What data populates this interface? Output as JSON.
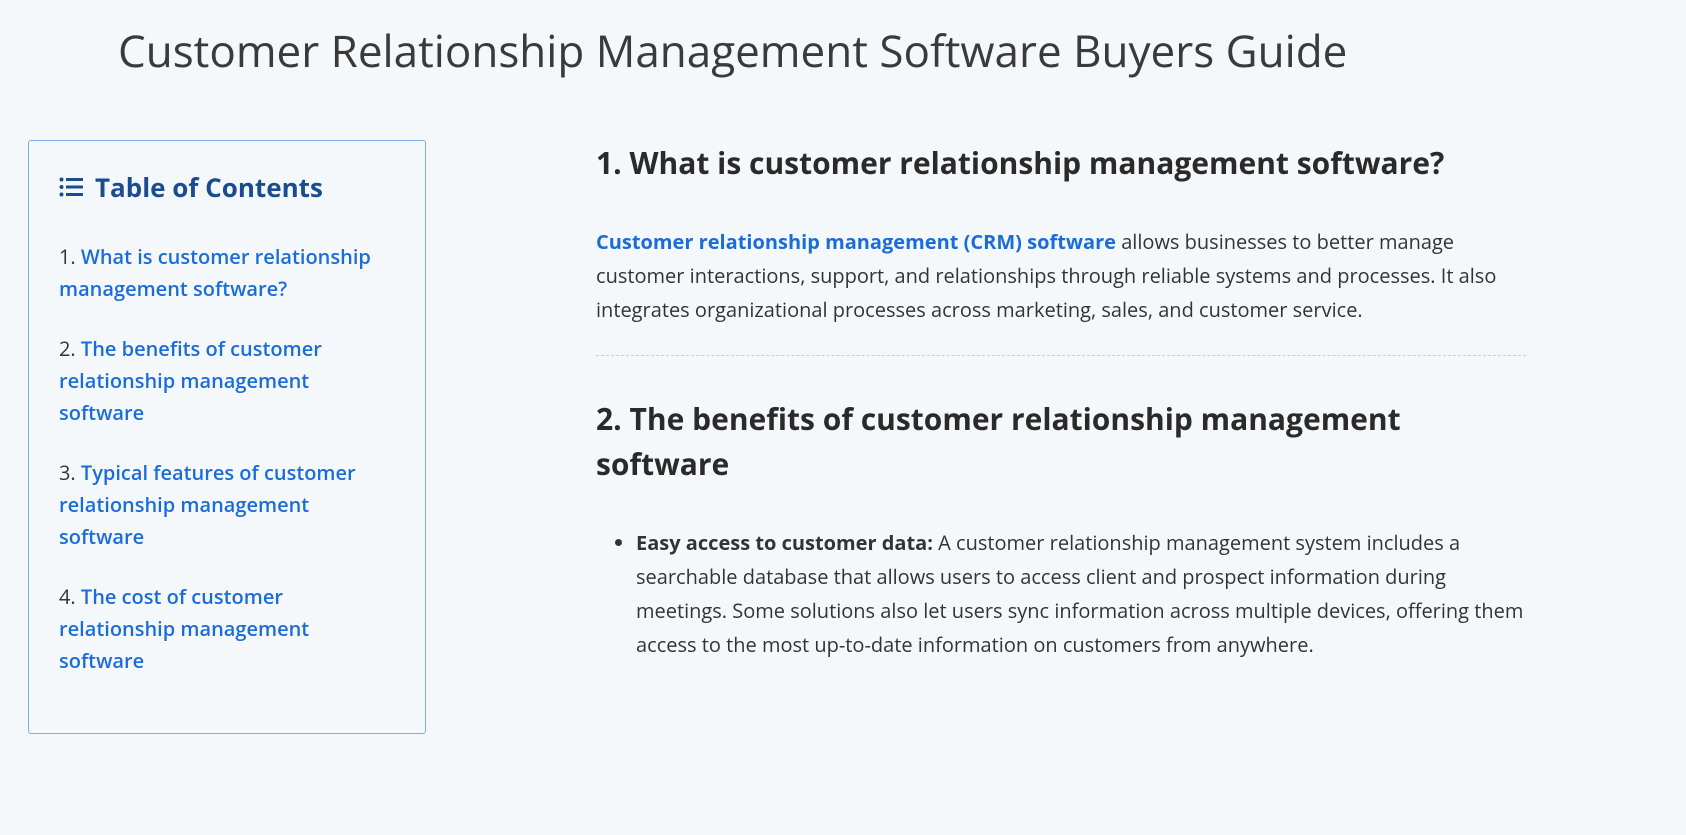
{
  "page_title": "Customer Relationship Management Software Buyers Guide",
  "toc": {
    "title": "Table of Contents",
    "items": [
      {
        "num": "1.",
        "label": "What is customer relationship management software?"
      },
      {
        "num": "2.",
        "label": "The benefits of customer relationship management software"
      },
      {
        "num": "3.",
        "label": "Typical features of customer relationship management software"
      },
      {
        "num": "4.",
        "label": "The cost of customer relationship management software"
      }
    ]
  },
  "sections": {
    "s1": {
      "heading": "1. What is customer relationship management software?",
      "link_text": "Customer relationship management (CRM) software",
      "rest": " allows businesses to better manage customer interactions, support, and relationships through reliable systems and processes. It also integrates organizational processes across marketing, sales, and customer service."
    },
    "s2": {
      "heading": "2. The benefits of customer relationship management software",
      "benefits": [
        {
          "label": "Easy access to customer data:",
          "text": " A customer relationship management system includes a searchable database that allows users to access client and prospect information during meetings. Some solutions also let users sync information across multiple devices, offering them access to the most up-to-date information on customers from anywhere."
        }
      ]
    }
  }
}
